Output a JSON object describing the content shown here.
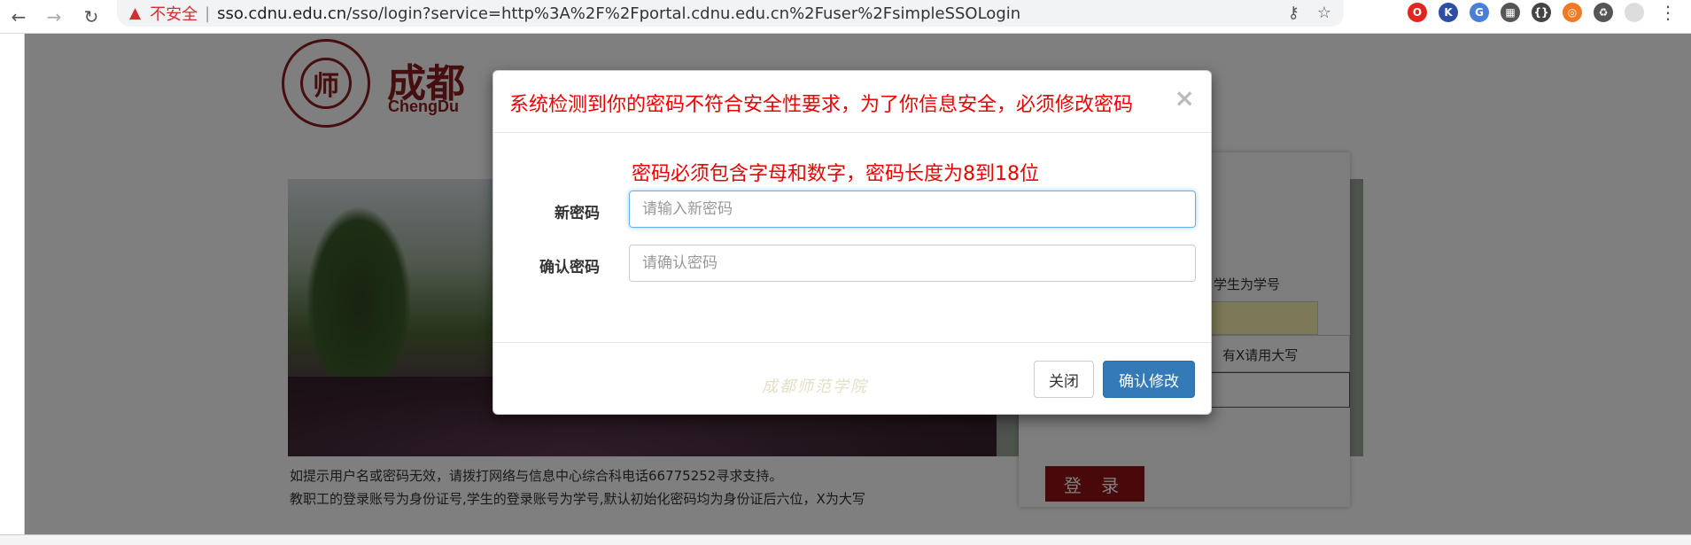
{
  "browser": {
    "security_label": "不安全",
    "separator": "|",
    "url_host": "sso.cdnu.edu.cn",
    "url_rest": "/sso/login?service=http%3A%2F%2Fportal.cdnu.edu.cn%2Fuser%2FsimpleSSOLogin",
    "icons": [
      "back-icon",
      "forward-icon",
      "reload-icon",
      "warning-icon",
      "key-icon",
      "star-icon"
    ],
    "extensions": [
      {
        "name": "opera-extension",
        "color": "#e0261d",
        "glyph": "O"
      },
      {
        "name": "k-extension",
        "color": "#2d4ea2",
        "glyph": "K"
      },
      {
        "name": "translate-extension",
        "color": "#4a7fd6",
        "glyph": "G"
      },
      {
        "name": "grid-extension",
        "color": "#555555",
        "glyph": "▦"
      },
      {
        "name": "json-extension",
        "color": "#444444",
        "glyph": "{}"
      },
      {
        "name": "orange-extension",
        "color": "#f07a23",
        "glyph": "◎"
      },
      {
        "name": "recycle-extension",
        "color": "#555555",
        "glyph": "♻"
      },
      {
        "name": "profile-extension",
        "color": "#dddddd",
        "glyph": ""
      }
    ]
  },
  "page": {
    "logo_cn": "成都",
    "logo_en": "ChengDu",
    "seal_char": "师",
    "stone_text": "成都师范学院",
    "student_hint": "学生为学号",
    "caps_hint": "有X请用大写",
    "password_mask": "•••••",
    "login_button": "登 录",
    "notice_line1": "如提示用户名或密码无效，请拨打网络与信息中心综合科电话66775252寻求支持。",
    "notice_line2": "教职工的登录账号为身份证号,学生的登录账号为学号,默认初始化密码均为身份证后六位，X为大写"
  },
  "modal": {
    "title": "系统检测到你的密码不符合安全性要求，为了你信息安全，必须修改密码",
    "close_glyph": "×",
    "rule": "密码必须包含字母和数字，密码长度为8到18位",
    "new_password_label": "新密码",
    "new_password_placeholder": "请输入新密码",
    "new_password_value": "",
    "confirm_password_label": "确认密码",
    "confirm_password_placeholder": "请确认密码",
    "confirm_password_value": "",
    "close_button": "关闭",
    "confirm_button": "确认修改"
  }
}
